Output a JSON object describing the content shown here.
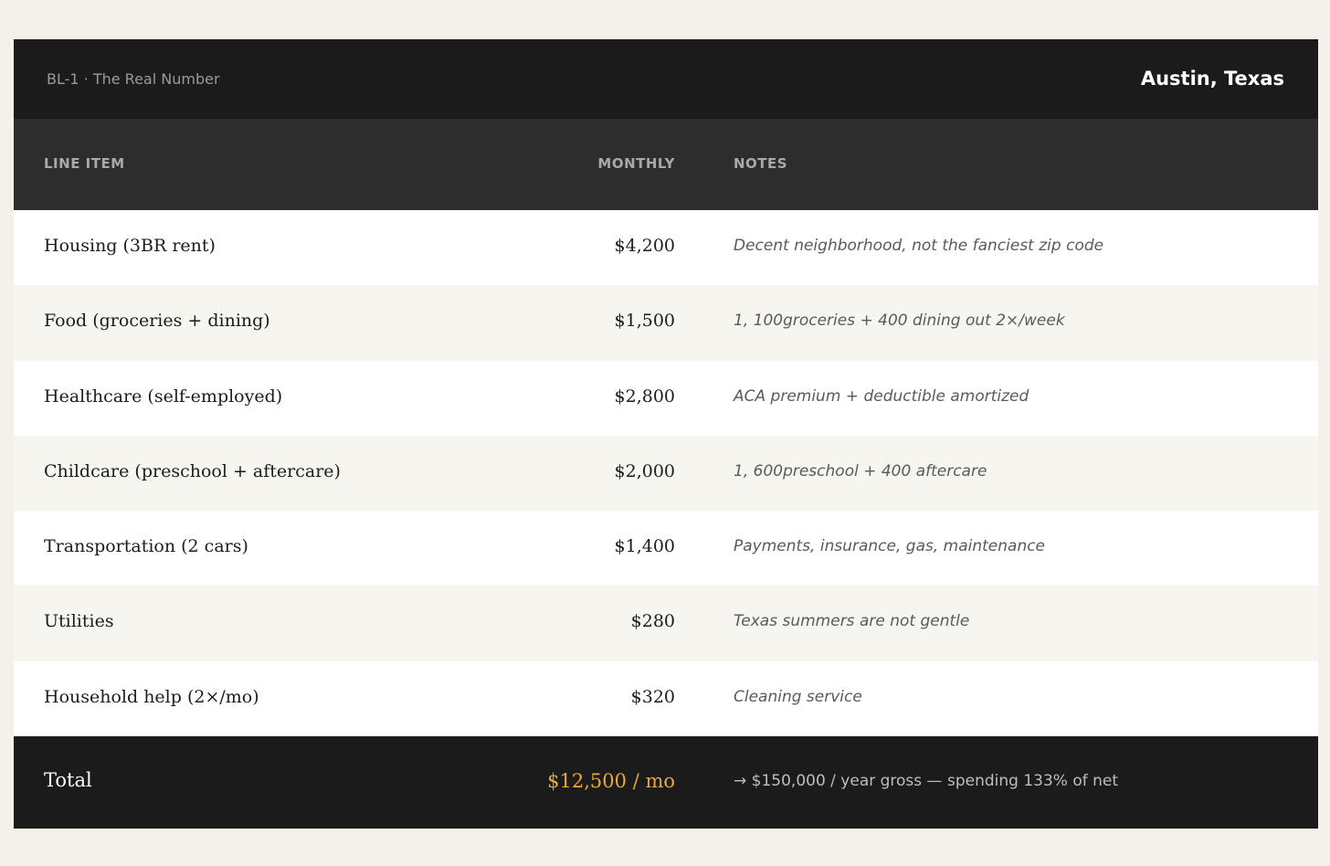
{
  "header": {
    "code": "BL-1 · The Real Number",
    "city": "Austin, Texas"
  },
  "columns": {
    "item": "LINE ITEM",
    "monthly": "MONTHLY",
    "notes": "NOTES"
  },
  "rows": [
    {
      "item": "Housing (3BR rent)",
      "amount": "$4,200",
      "note": "Decent neighborhood, not the fanciest zip code"
    },
    {
      "item": "Food (groceries + dining)",
      "amount": "$1,500",
      "note": "1, 100groceries + 400 dining out 2×/week"
    },
    {
      "item": "Healthcare (self-employed)",
      "amount": "$2,800",
      "note": "ACA premium + deductible amortized"
    },
    {
      "item": "Childcare (preschool + aftercare)",
      "amount": "$2,000",
      "note": "1, 600preschool + 400 aftercare"
    },
    {
      "item": "Transportation (2 cars)",
      "amount": "$1,400",
      "note": "Payments, insurance, gas, maintenance"
    },
    {
      "item": "Utilities",
      "amount": "$280",
      "note": "Texas summers are not gentle"
    },
    {
      "item": "Household help (2×/mo)",
      "amount": "$320",
      "note": "Cleaning service"
    }
  ],
  "total": {
    "label": "Total",
    "value": "$12,500 / mo",
    "summary": "→  $150,000 / year gross — spending 133% of net"
  },
  "colors": {
    "background": "#f4f1eb",
    "header_dark": "#1b1b1b",
    "table_head": "#2d2d2d",
    "accent_total": "#e8a93a"
  }
}
